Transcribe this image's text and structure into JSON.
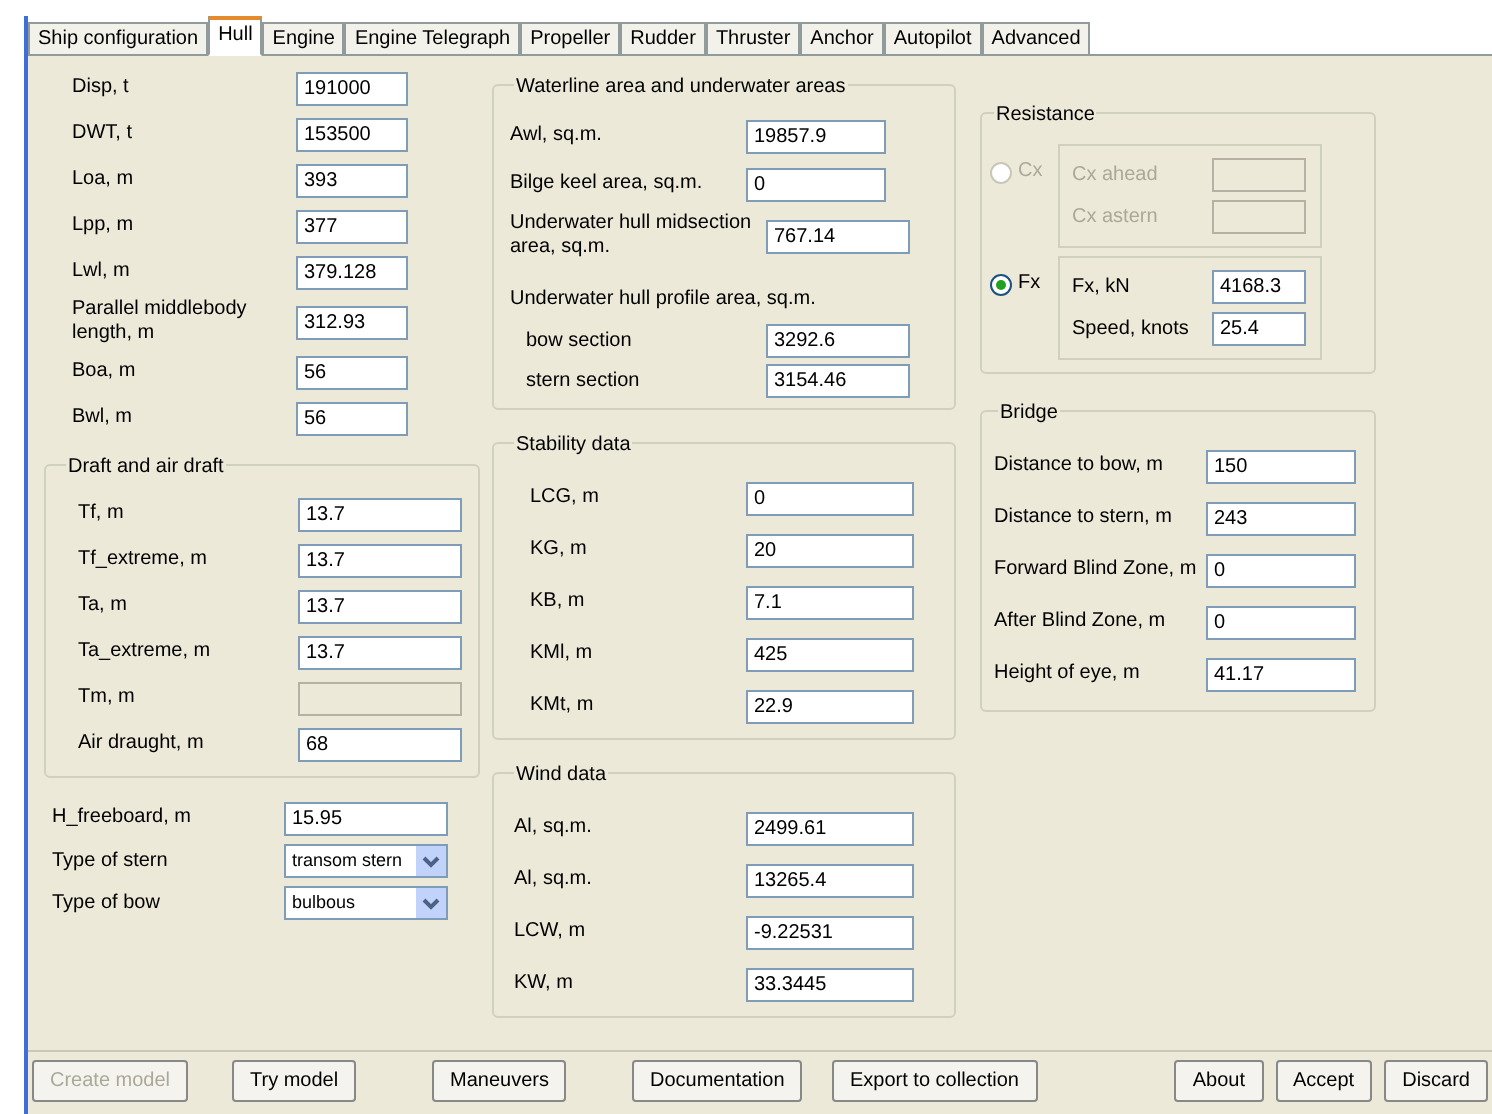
{
  "tabs": [
    {
      "label": "Ship configuration",
      "selected": false
    },
    {
      "label": "Hull",
      "selected": true
    },
    {
      "label": "Engine",
      "selected": false
    },
    {
      "label": "Engine Telegraph",
      "selected": false
    },
    {
      "label": "Propeller",
      "selected": false
    },
    {
      "label": "Rudder",
      "selected": false
    },
    {
      "label": "Thruster",
      "selected": false
    },
    {
      "label": "Anchor",
      "selected": false
    },
    {
      "label": "Autopilot",
      "selected": false
    },
    {
      "label": "Advanced",
      "selected": false
    }
  ],
  "hull": {
    "fields": [
      {
        "label": "Disp, t",
        "value": "191000"
      },
      {
        "label": "DWT, t",
        "value": "153500"
      },
      {
        "label": "Loa, m",
        "value": "393"
      },
      {
        "label": "Lpp, m",
        "value": "377"
      },
      {
        "label": "Lwl, m",
        "value": "379.128"
      },
      {
        "label": "Parallel middlebody length, m",
        "value": "312.93"
      },
      {
        "label": "Boa, m",
        "value": "56"
      },
      {
        "label": "Bwl, m",
        "value": "56"
      }
    ],
    "draft": {
      "title": "Draft and air draft",
      "fields": [
        {
          "label": "Tf, m",
          "value": "13.7",
          "disabled": false
        },
        {
          "label": "Tf_extreme, m",
          "value": "13.7",
          "disabled": false
        },
        {
          "label": "Ta, m",
          "value": "13.7",
          "disabled": false
        },
        {
          "label": "Ta_extreme, m",
          "value": "13.7",
          "disabled": false
        },
        {
          "label": "Tm, m",
          "disabled": true
        },
        {
          "label": "Air draught, m",
          "value": "68",
          "disabled": false
        }
      ]
    },
    "freeboard": {
      "label": "H_freeboard, m",
      "value": "15.95"
    },
    "selects": [
      {
        "label": "Type of stern",
        "value": "transom stern"
      },
      {
        "label": "Type of bow",
        "value": "bulbous"
      }
    ]
  },
  "waterline": {
    "title": "Waterline area and underwater areas",
    "fields": [
      {
        "label": "Awl, sq.m.",
        "value": "19857.9"
      },
      {
        "label": "Bilge keel area, sq.m.",
        "value": "0"
      },
      {
        "label": "Underwater hull midsection area, sq.m.",
        "value": "767.14"
      }
    ],
    "profile": {
      "title": "Underwater hull profile area, sq.m.",
      "fields": [
        {
          "label": "bow section",
          "value": "3292.6"
        },
        {
          "label": "stern section",
          "value": "3154.46"
        }
      ]
    }
  },
  "stability": {
    "title": "Stability data",
    "fields": [
      {
        "label": "LCG, m",
        "value": "0"
      },
      {
        "label": "KG, m",
        "value": "20"
      },
      {
        "label": "KB, m",
        "value": "7.1"
      },
      {
        "label": "KMl, m",
        "value": "425"
      },
      {
        "label": "KMt, m",
        "value": "22.9"
      }
    ]
  },
  "wind": {
    "title": "Wind data",
    "fields": [
      {
        "label": "Al, sq.m.",
        "value": "2499.61"
      },
      {
        "label": "Al, sq.m.",
        "value": "13265.4"
      },
      {
        "label": "LCW, m",
        "value": "-9.22531"
      },
      {
        "label": "KW, m",
        "value": "33.3445"
      }
    ]
  },
  "resistance": {
    "title": "Resistance",
    "options": [
      {
        "label": "Cx",
        "selected": false,
        "fields": [
          {
            "label": "Cx ahead"
          },
          {
            "label": "Cx astern"
          }
        ]
      },
      {
        "label": "Fx",
        "selected": true,
        "fields": [
          {
            "label": "Fx, kN",
            "value": "4168.3"
          },
          {
            "label": "Speed, knots",
            "value": "25.4"
          }
        ]
      }
    ]
  },
  "bridge": {
    "title": "Bridge",
    "fields": [
      {
        "label": "Distance to bow, m",
        "value": "150"
      },
      {
        "label": "Distance to stern, m",
        "value": "243"
      },
      {
        "label": "Forward Blind Zone, m",
        "value": "0"
      },
      {
        "label": "After Blind Zone, m",
        "value": "0"
      },
      {
        "label": "Height of eye, m",
        "value": "41.17"
      }
    ]
  },
  "buttons_left": [
    {
      "label": "Create model",
      "disabled": true
    },
    {
      "label": "Try model",
      "disabled": false
    },
    {
      "label": "Maneuvers",
      "disabled": false
    },
    {
      "label": "Documentation",
      "disabled": false
    },
    {
      "label": "Export to collection",
      "disabled": false
    }
  ],
  "buttons_right": [
    {
      "label": "About",
      "disabled": false
    },
    {
      "label": "Accept",
      "disabled": false
    },
    {
      "label": "Discard",
      "disabled": false
    }
  ]
}
